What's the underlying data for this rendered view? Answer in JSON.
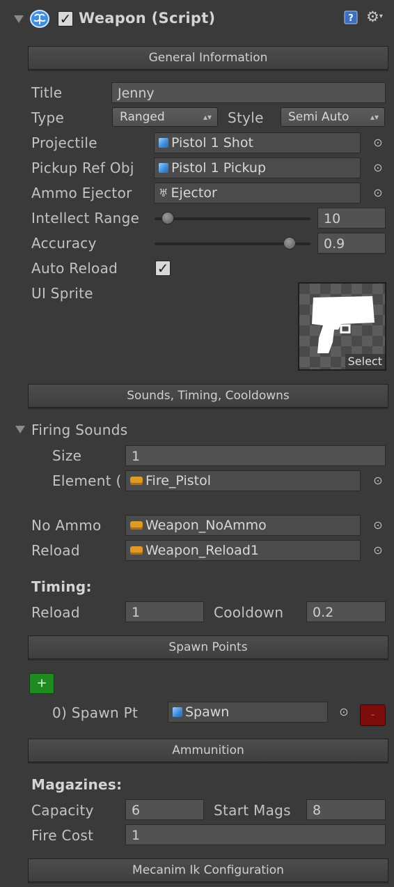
{
  "header": {
    "title": "Weapon (Script)",
    "enabled": true,
    "help_icon": "help-book-icon",
    "gear_icon": "gear-icon",
    "script_icon": "script-brain-icon"
  },
  "sections": {
    "general": "General Information",
    "sounds": "Sounds, Timing, Cooldowns",
    "spawn": "Spawn Points",
    "ammo": "Ammunition",
    "mecanim": "Mecanim Ik Configuration"
  },
  "general": {
    "title_label": "Title",
    "title_value": "Jenny",
    "type_label": "Type",
    "type_value": "Ranged",
    "style_label": "Style",
    "style_value": "Semi Auto",
    "projectile_label": "Projectile",
    "projectile_value": "Pistol 1 Shot",
    "pickup_label": "Pickup Ref Obj",
    "pickup_value": "Pistol 1 Pickup",
    "ejector_label": "Ammo Ejector",
    "ejector_value": "Ejector",
    "intellect_label": "Intellect Range",
    "intellect_value": "10",
    "intellect_fraction": 0.05,
    "accuracy_label": "Accuracy",
    "accuracy_value": "0.9",
    "accuracy_fraction": 0.9,
    "auto_reload_label": "Auto Reload",
    "auto_reload": true,
    "ui_sprite_label": "UI Sprite",
    "select_label": "Select"
  },
  "sounds": {
    "firing_label": "Firing Sounds",
    "size_label": "Size",
    "size_value": "1",
    "element_label": "Element (",
    "element_value": "Fire_Pistol",
    "noammo_label": "No Ammo",
    "noammo_value": "Weapon_NoAmmo",
    "reload_label": "Reload",
    "reload_value": "Weapon_Reload1"
  },
  "timing": {
    "heading": "Timing:",
    "reload_label": "Reload",
    "reload_value": "1",
    "cooldown_label": "Cooldown",
    "cooldown_value": "0.2"
  },
  "spawn": {
    "add_label": "+",
    "point_label": "0) Spawn Pt",
    "point_value": "Spawn",
    "remove_label": "-"
  },
  "ammo": {
    "heading": "Magazines:",
    "capacity_label": "Capacity",
    "capacity_value": "6",
    "start_label": "Start Mags",
    "start_value": "8",
    "cost_label": "Fire Cost",
    "cost_value": "1"
  },
  "colors": {
    "background": "#3a3a3a",
    "field": "#525252",
    "add_button": "#1f8a1f",
    "remove_button": "#7a0c0c"
  }
}
